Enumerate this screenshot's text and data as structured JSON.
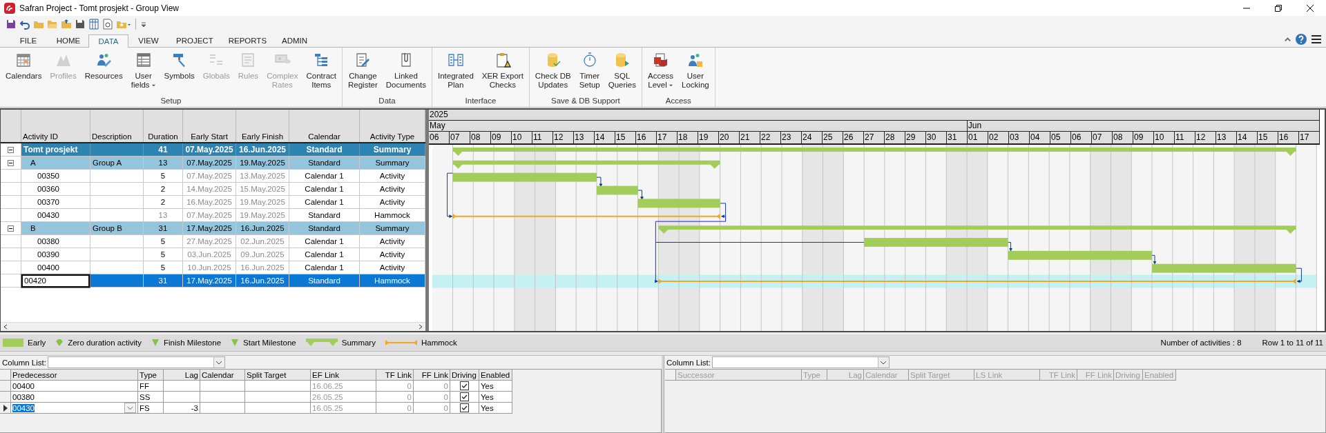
{
  "window": {
    "title": "Safran Project - Tomt prosjekt - Group View"
  },
  "ribbon_tabs": [
    {
      "label": "FILE",
      "selected": false
    },
    {
      "label": "HOME",
      "selected": false
    },
    {
      "label": "DATA",
      "selected": true
    },
    {
      "label": "VIEW",
      "selected": false
    },
    {
      "label": "PROJECT",
      "selected": false
    },
    {
      "label": "REPORTS",
      "selected": false
    },
    {
      "label": "ADMIN",
      "selected": false
    }
  ],
  "ribbon_groups": [
    {
      "label": "Setup",
      "buttons": [
        {
          "lines": [
            "Calendars"
          ],
          "disabled": false,
          "dropdown": false
        },
        {
          "lines": [
            "Profiles"
          ],
          "disabled": true,
          "dropdown": false
        },
        {
          "lines": [
            "Resources"
          ],
          "disabled": false,
          "dropdown": false
        },
        {
          "lines": [
            "User",
            "fields"
          ],
          "disabled": false,
          "dropdown": true
        },
        {
          "lines": [
            "Symbols"
          ],
          "disabled": false,
          "dropdown": false
        },
        {
          "lines": [
            "Globals"
          ],
          "disabled": true,
          "dropdown": false
        },
        {
          "lines": [
            "Rules"
          ],
          "disabled": true,
          "dropdown": false
        },
        {
          "lines": [
            "Complex",
            "Rates"
          ],
          "disabled": true,
          "dropdown": false
        },
        {
          "lines": [
            "Contract",
            "Items"
          ],
          "disabled": false,
          "dropdown": false
        }
      ]
    },
    {
      "label": "Data",
      "buttons": [
        {
          "lines": [
            "Change",
            "Register"
          ],
          "disabled": false,
          "dropdown": false
        },
        {
          "lines": [
            "Linked",
            "Documents"
          ],
          "disabled": false,
          "dropdown": false
        }
      ]
    },
    {
      "label": "Interface",
      "buttons": [
        {
          "lines": [
            "Integrated",
            "Plan"
          ],
          "disabled": false,
          "dropdown": false
        },
        {
          "lines": [
            "XER Export",
            "Checks"
          ],
          "disabled": false,
          "dropdown": false
        }
      ]
    },
    {
      "label": "Save & DB  Support",
      "buttons": [
        {
          "lines": [
            "Check DB",
            "Updates"
          ],
          "disabled": false,
          "dropdown": false
        },
        {
          "lines": [
            "Timer",
            "Setup"
          ],
          "disabled": false,
          "dropdown": false
        },
        {
          "lines": [
            "SQL",
            "Queries"
          ],
          "disabled": false,
          "dropdown": false
        }
      ]
    },
    {
      "label": "Access",
      "buttons": [
        {
          "lines": [
            "Access",
            "Level"
          ],
          "disabled": false,
          "dropdown": true
        },
        {
          "lines": [
            "User",
            "Locking"
          ],
          "disabled": false,
          "dropdown": false
        }
      ]
    }
  ],
  "grid": {
    "columns": [
      "Activity ID",
      "Description",
      "Duration",
      "Early Start",
      "Early Finish",
      "Calendar",
      "Activity Type"
    ],
    "rows": [
      {
        "kind": "project",
        "id": "Tomt prosjekt",
        "duration": "41",
        "early_start": "07.May.2025",
        "early_finish": "16.Jun.2025",
        "calendar": "Standard",
        "activity_type": "Summary",
        "expanded": true,
        "selected": false,
        "children": [
          {
            "kind": "group",
            "id": "A",
            "description": "Group A",
            "duration": "13",
            "early_start": "07.May.2025",
            "early_finish": "19.May.2025",
            "calendar": "Standard",
            "activity_type": "Summary",
            "expanded": true,
            "selected": false,
            "children": [
              {
                "kind": "activity",
                "id": "00350",
                "duration": "5",
                "early_start": "07.May.2025",
                "early_finish": "13.May.2025",
                "calendar": "Calendar 1",
                "activity_type": "Activity",
                "selected": false
              },
              {
                "kind": "activity",
                "id": "00360",
                "duration": "2",
                "early_start": "14.May.2025",
                "early_finish": "15.May.2025",
                "calendar": "Calendar 1",
                "activity_type": "Activity",
                "selected": false
              },
              {
                "kind": "activity",
                "id": "00370",
                "duration": "2",
                "early_start": "16.May.2025",
                "early_finish": "19.May.2025",
                "calendar": "Calendar 1",
                "activity_type": "Activity",
                "selected": false
              },
              {
                "kind": "hammock",
                "id": "00430",
                "duration": "13",
                "early_start": "07.May.2025",
                "early_finish": "19.May.2025",
                "calendar": "Standard",
                "activity_type": "Hammock",
                "selected": false
              }
            ]
          },
          {
            "kind": "group",
            "id": "B",
            "description": "Group B",
            "duration": "31",
            "early_start": "17.May.2025",
            "early_finish": "16.Jun.2025",
            "calendar": "Standard",
            "activity_type": "Summary",
            "expanded": true,
            "selected": false,
            "children": [
              {
                "kind": "activity",
                "id": "00380",
                "duration": "5",
                "early_start": "27.May.2025",
                "early_finish": "02.Jun.2025",
                "calendar": "Calendar 1",
                "activity_type": "Activity",
                "selected": false
              },
              {
                "kind": "activity",
                "id": "00390",
                "duration": "5",
                "early_start": "03.Jun.2025",
                "early_finish": "09.Jun.2025",
                "calendar": "Calendar 1",
                "activity_type": "Activity",
                "selected": false
              },
              {
                "kind": "activity",
                "id": "00400",
                "duration": "5",
                "early_start": "10.Jun.2025",
                "early_finish": "16.Jun.2025",
                "calendar": "Calendar 1",
                "activity_type": "Activity",
                "selected": false
              },
              {
                "kind": "hammock",
                "id": "00420",
                "duration": "31",
                "early_start": "17.May.2025",
                "early_finish": "16.Jun.2025",
                "calendar": "Standard",
                "activity_type": "Hammock",
                "selected": true
              }
            ]
          }
        ]
      }
    ]
  },
  "gantt": {
    "year": "2025",
    "months": [
      {
        "label": "May",
        "days": [
          "06",
          "07",
          "08",
          "09",
          "10",
          "11",
          "12",
          "13",
          "14",
          "15",
          "16",
          "17",
          "18",
          "19",
          "20",
          "21",
          "22",
          "23",
          "24",
          "25",
          "26",
          "27",
          "28",
          "29",
          "30",
          "31"
        ]
      },
      {
        "label": "Jun",
        "days": [
          "01",
          "02",
          "03",
          "04",
          "05",
          "06",
          "07",
          "08",
          "09",
          "10",
          "11",
          "12",
          "13",
          "14",
          "15",
          "16",
          "17"
        ]
      }
    ]
  },
  "legend": [
    {
      "kind": "early",
      "label": "Early"
    },
    {
      "kind": "zero",
      "label": "Zero duration activity"
    },
    {
      "kind": "finish",
      "label": "Finish Milestone"
    },
    {
      "kind": "start",
      "label": "Start Milestone"
    },
    {
      "kind": "summary",
      "label": "Summary"
    },
    {
      "kind": "hammock",
      "label": "Hammock"
    }
  ],
  "status": [
    "Number of activities : 8",
    "Row 1 to 11 of 11"
  ],
  "predecessors": {
    "column_list_label": "Column List:",
    "disabled": false,
    "columns": [
      "Predecessor",
      "Type",
      "Lag",
      "Calendar",
      "Split Target",
      "EF Link",
      "TF Link",
      "FF Link",
      "Driving",
      "Enabled"
    ],
    "rows": [
      {
        "predecessor": "00400",
        "type": "FF",
        "ef_link": "16.06.25",
        "tf_link": "0",
        "ff_link": "0",
        "driving": true,
        "enabled": "Yes",
        "selected": false
      },
      {
        "predecessor": "00380",
        "type": "SS",
        "ef_link": "26.05.25",
        "tf_link": "0",
        "ff_link": "0",
        "driving": true,
        "enabled": "Yes",
        "selected": false
      },
      {
        "predecessor": "00430",
        "type": "FS",
        "lag": "-3",
        "ef_link": "16.05.25",
        "tf_link": "0",
        "ff_link": "0",
        "driving": true,
        "enabled": "Yes",
        "selected": true
      }
    ]
  },
  "successors": {
    "column_list_label": "Column List:",
    "disabled": true,
    "columns": [
      "Successor",
      "Type",
      "Lag",
      "Calendar",
      "Split Target",
      "LS Link",
      "TF Link",
      "FF Link",
      "Driving",
      "Enabled"
    ]
  }
}
